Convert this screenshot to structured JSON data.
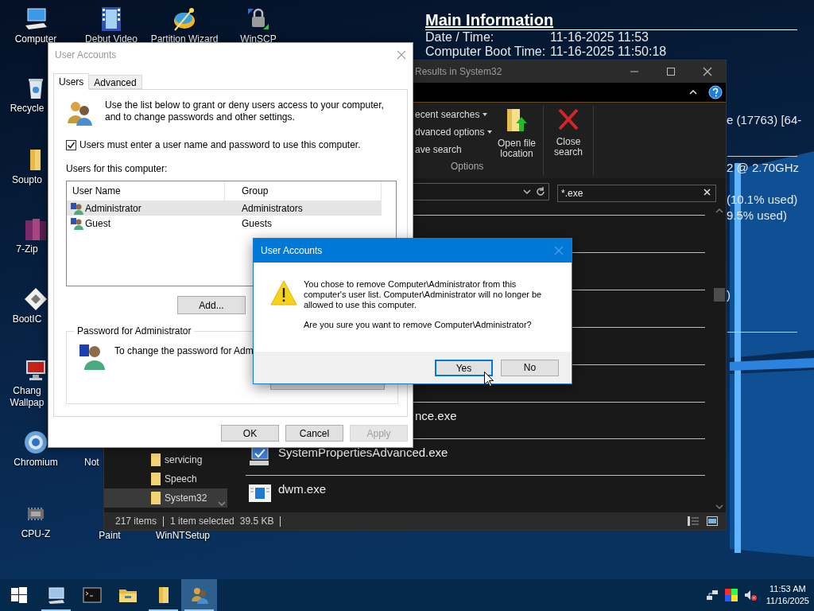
{
  "desktop": {
    "icons": [
      {
        "label": "Computer"
      },
      {
        "label": "Debut Video"
      },
      {
        "label": "Partition Wizard"
      },
      {
        "label": "WinSCP"
      },
      {
        "label": "Recycle"
      },
      {
        "label": "Soupto"
      },
      {
        "label": "7-Zip"
      },
      {
        "label": "BootIC"
      },
      {
        "label": "Chang Wallpap"
      },
      {
        "label": "Chromium"
      },
      {
        "label": "Not"
      },
      {
        "label": "CPU-Z"
      },
      {
        "label": "Paint"
      },
      {
        "label": "WinNTSetup"
      }
    ]
  },
  "info_panel": {
    "title": "Main Information",
    "rows": [
      {
        "label": "Date / Time:",
        "value": "11-16-2025 11:53"
      },
      {
        "label": "Computer Boot Time:",
        "value": "11-16-2025 11:50:18"
      }
    ],
    "fragments": [
      "e (17763) [64-",
      "2 @ 2.70GHz",
      "(10.1% used)",
      "9.5% used)",
      ")"
    ]
  },
  "explorer": {
    "title": "Results in System32",
    "ribbon": {
      "commands": [
        {
          "label": "ecent searches",
          "dropdown": true
        },
        {
          "label": "dvanced options",
          "dropdown": true
        },
        {
          "label": "ave search",
          "dropdown": false
        }
      ],
      "buttons": [
        "Open file location",
        "Close search"
      ],
      "group_label": "Options"
    },
    "search": {
      "value": "*.exe"
    },
    "nav_items": [
      {
        "label": "servicing",
        "selected": false
      },
      {
        "label": "Speech",
        "selected": false
      },
      {
        "label": "System32",
        "selected": true
      }
    ],
    "files": [
      {
        "name": "nce.exe",
        "kind": "clipped"
      },
      {
        "name": "SystemPropertiesAdvanced.exe",
        "kind": "settings"
      },
      {
        "name": "dwm.exe",
        "kind": "window"
      }
    ],
    "status_bar": {
      "count": "217 items",
      "selection": "1 item selected",
      "size": "39.5 KB"
    }
  },
  "user_accounts": {
    "title": "User Accounts",
    "tabs": [
      {
        "label": "Users",
        "selected": true
      },
      {
        "label": "Advanced",
        "selected": false
      }
    ],
    "intro": "Use the list below to grant or deny users access to your computer, and to change passwords and other settings.",
    "require_login": {
      "label": "Users must enter a user name and password to use this computer.",
      "checked": true
    },
    "list_label": "Users for this computer:",
    "columns": [
      "User Name",
      "Group"
    ],
    "rows": [
      {
        "cells": [
          "Administrator",
          "Administrators"
        ],
        "selected": true
      },
      {
        "cells": [
          "Guest",
          "Guests"
        ],
        "selected": false
      }
    ],
    "add_button": "Add...",
    "password_group": {
      "title": "Password for Administrator",
      "text": "To change the password for Adm"
    },
    "buttons": [
      {
        "label": "OK",
        "disabled": false
      },
      {
        "label": "Cancel",
        "disabled": false
      },
      {
        "label": "Apply",
        "disabled": true
      }
    ]
  },
  "dialog": {
    "title": "User Accounts",
    "message": [
      "You chose to remove Computer\\Administrator from this computer's user list. Computer\\Administrator will no longer be allowed to use this computer.",
      "Are you sure you want to remove Computer\\Administrator?"
    ],
    "buttons": [
      {
        "label": "Yes",
        "focused": true
      },
      {
        "label": "No",
        "focused": false
      }
    ]
  },
  "taskbar": {
    "apps": [
      {
        "running": true,
        "selected": false
      },
      {
        "running": false,
        "selected": false
      },
      {
        "running": false,
        "selected": false
      },
      {
        "running": true,
        "selected": false
      },
      {
        "running": true,
        "selected": true
      }
    ],
    "clock": {
      "time": "11:53 AM",
      "date": "11/16/2025"
    }
  }
}
